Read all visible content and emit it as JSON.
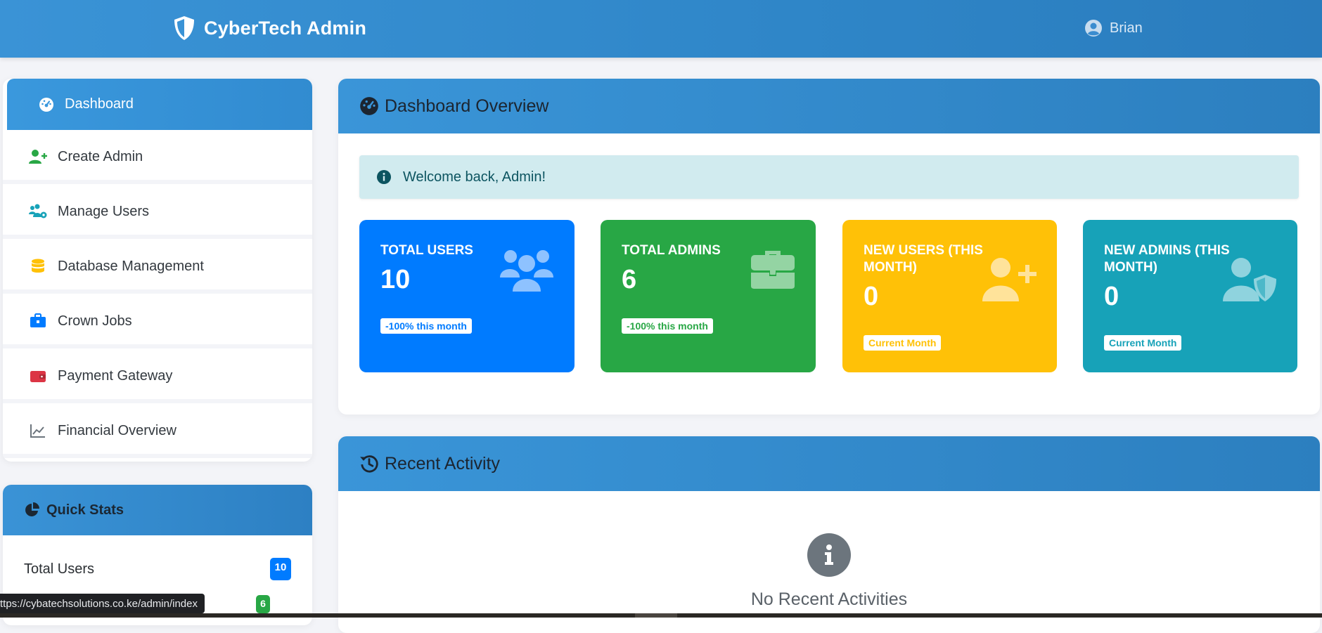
{
  "header": {
    "brand": "CyberTech Admin",
    "user_name": "Brian"
  },
  "sidebar": {
    "items": [
      {
        "label": "Dashboard",
        "icon": "gauge-icon",
        "active": true
      },
      {
        "label": "Create Admin",
        "icon": "user-plus-icon",
        "color": "#28a745"
      },
      {
        "label": "Manage Users",
        "icon": "users-cog-icon",
        "color": "#17a2b8"
      },
      {
        "label": "Database Management",
        "icon": "database-icon",
        "color": "#ffc107"
      },
      {
        "label": "Crown Jobs",
        "icon": "briefcase-icon",
        "color": "#007bff"
      },
      {
        "label": "Payment Gateway",
        "icon": "wallet-icon",
        "color": "#dc3545"
      },
      {
        "label": "Financial Overview",
        "icon": "chart-line-icon",
        "color": "#6c757d"
      }
    ]
  },
  "quick_stats": {
    "title": "Quick Stats",
    "rows": [
      {
        "label": "Total Users",
        "value": "10",
        "color": "#007bff"
      },
      {
        "label": "",
        "value": "6",
        "color": "#28a745"
      }
    ]
  },
  "overview": {
    "title": "Dashboard Overview",
    "welcome": "Welcome back, Admin!",
    "cards": [
      {
        "title": "TOTAL USERS",
        "value": "10",
        "badge": "-100% this month",
        "bg": "#007bff",
        "icon": "users-icon"
      },
      {
        "title": "TOTAL ADMINS",
        "value": "6",
        "badge": "-100% this month",
        "bg": "#28a745",
        "icon": "briefcase-icon"
      },
      {
        "title": "NEW USERS (THIS MONTH)",
        "value": "0",
        "badge": "Current Month",
        "bg": "#ffc107",
        "icon": "user-plus-icon"
      },
      {
        "title": "NEW ADMINS (THIS MONTH)",
        "value": "0",
        "badge": "Current Month",
        "bg": "#17a2b8",
        "icon": "user-shield-icon"
      }
    ]
  },
  "activity": {
    "title": "Recent Activity",
    "empty_text": "No Recent Activities"
  },
  "status_bar": {
    "url": "ttps://cybatechsolutions.co.ke/admin/index"
  }
}
